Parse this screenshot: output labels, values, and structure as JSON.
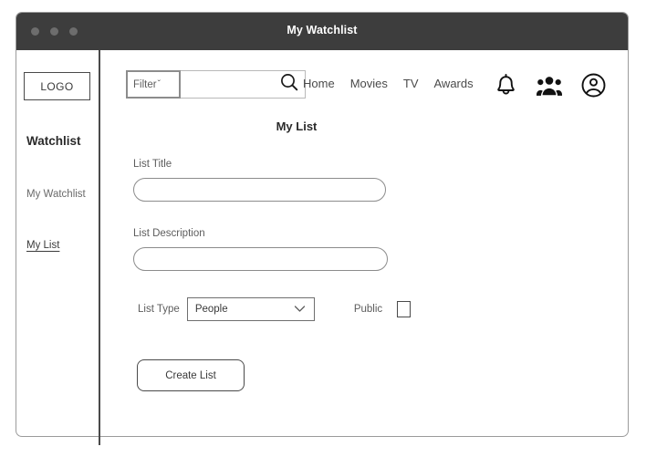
{
  "window": {
    "title": "My Watchlist",
    "controls": [
      "close-dot",
      "minimize-dot",
      "maximize-dot"
    ]
  },
  "sidebar": {
    "logo": "LOGO",
    "heading": "Watchlist",
    "items": [
      {
        "label": "My Watchlist",
        "active": false
      },
      {
        "label": "My List",
        "active": true
      }
    ]
  },
  "topbar": {
    "filter": {
      "label": "Filter",
      "caret": "ˇ"
    },
    "search": {
      "value": "",
      "placeholder": ""
    },
    "nav_links": [
      "Home",
      "Movies",
      "TV",
      "Awards"
    ],
    "icons": [
      "notification-bell-icon",
      "people-group-icon",
      "account-circle-icon"
    ]
  },
  "main": {
    "page_title": "My List",
    "fields": {
      "list_title": {
        "label": "List Title",
        "value": "",
        "placeholder": ""
      },
      "list_description": {
        "label": "List Description",
        "value": "",
        "placeholder": ""
      },
      "list_type": {
        "label": "List Type",
        "value": "People",
        "options": [
          "People"
        ]
      },
      "public": {
        "label": "Public",
        "checked": false
      }
    },
    "submit_label": "Create List"
  },
  "colors": {
    "titlebar_bg": "#3d3d3d",
    "titlebar_text": "#ffffff",
    "window_border": "#9b9b9b",
    "divider": "#4a4a4a",
    "label_text": "#5d5d5d",
    "heading_text": "#2b2b2b",
    "input_border": "#8c8c8c",
    "page_bg": "#ffffff"
  }
}
